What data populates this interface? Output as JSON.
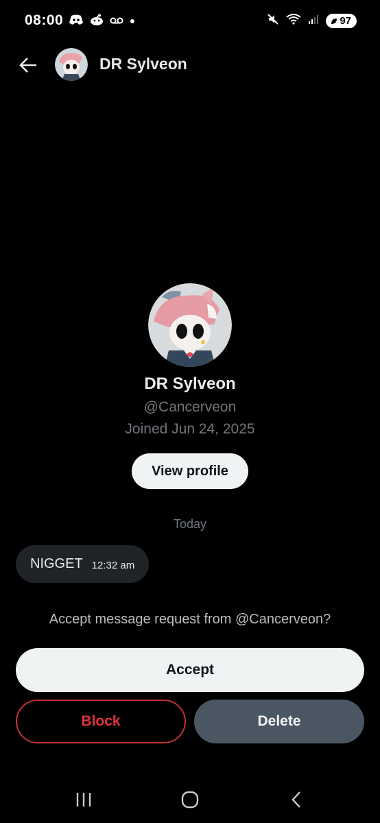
{
  "status_bar": {
    "time": "08:00",
    "battery": "97",
    "left_icons": [
      "discord-icon",
      "reddit-icon",
      "voicemail-icon",
      "notification-dot-icon"
    ],
    "right_icons": [
      "mute-icon",
      "wifi-icon",
      "signal-icon",
      "battery-icon"
    ]
  },
  "header": {
    "back_icon": "arrow-left-icon",
    "name": "DR Sylveon"
  },
  "profile": {
    "name": "DR Sylveon",
    "handle": "@Cancerveon",
    "joined": "Joined Jun 24, 2025",
    "view_profile_label": "View profile"
  },
  "conversation": {
    "date_divider": "Today",
    "messages": [
      {
        "text": "NIGGET",
        "time": "12:32 am"
      }
    ]
  },
  "request": {
    "prompt": "Accept message request from @Cancerveon?",
    "accept_label": "Accept",
    "block_label": "Block",
    "delete_label": "Delete"
  },
  "nav_bar": {
    "buttons": [
      "recent-apps-icon",
      "home-icon",
      "back-icon"
    ]
  },
  "colors": {
    "background": "#000000",
    "text_primary": "#e7e9ea",
    "text_secondary": "#71767b",
    "button_light": "#eff3f4",
    "block_red": "#e0343f",
    "delete_gray": "#4b5663",
    "bubble": "#202327"
  }
}
